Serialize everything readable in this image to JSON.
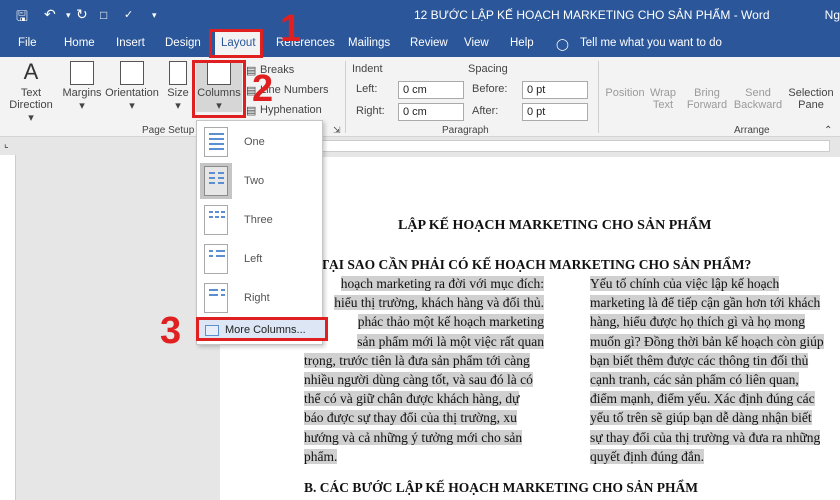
{
  "titlebar": {
    "title": "12 BƯỚC LẬP KẾ HOẠCH MARKETING CHO SẢN PHẨM  -  Word",
    "user": "Ng",
    "save_icon": "save-icon",
    "undo_icon": "undo-icon",
    "redo_icon": "redo-icon"
  },
  "menu": {
    "file": "File",
    "home": "Home",
    "insert": "Insert",
    "design": "Design",
    "layout": "Layout",
    "references": "References",
    "mailings": "Mailings",
    "review": "Review",
    "view": "View",
    "help": "Help",
    "tell_me": "Tell me what you want to do"
  },
  "ribbon": {
    "text_direction": "Text",
    "text_direction2": "Direction",
    "margins": "Margins",
    "orientation": "Orientation",
    "size": "Size",
    "columns": "Columns",
    "breaks": "Breaks",
    "line_numbers": "Line Numbers",
    "hyphenation": "Hyphenation",
    "page_setup": "Page Setup",
    "indent": "Indent",
    "spacing": "Spacing",
    "left": "Left:",
    "right": "Right:",
    "before": "Before:",
    "after": "After:",
    "left_val": "0 cm",
    "right_val": "0 cm",
    "before_val": "0 pt",
    "after_val": "0 pt",
    "paragraph": "Paragraph",
    "position": "Position",
    "wrap_text": "Wrap",
    "wrap_text2": "Text",
    "bring_forward": "Bring",
    "bring_forward2": "Forward",
    "send_backward": "Send",
    "send_backward2": "Backward",
    "selection_pane": "Selection",
    "selection_pane2": "Pane",
    "arrange": "Arrange"
  },
  "columns_menu": {
    "items": [
      "One",
      "Two",
      "Three",
      "Left",
      "Right"
    ],
    "more": "More Columns..."
  },
  "callouts": {
    "n1": "1",
    "n2": "2",
    "n3": "3"
  },
  "document": {
    "title": "LẬP KẾ HOẠCH MARKETING CHO SẢN PHẨM",
    "heading_a": "TẠI SAO CẦN PHẢI CÓ KẾ HOẠCH MARKETING CHO SẢN PHẨM?",
    "col1": [
      "hoạch marketing ra đời với mục đích:",
      "hiểu thị trường, khách hàng và đối thủ.",
      "phác thảo một kế hoạch marketing",
      "sản phẩm mới là một việc rất quan",
      "trọng, trước tiên là đưa sản phẩm tới càng",
      "nhiều người dùng càng tốt, và sau đó là có",
      "thể có và giữ chân được khách hàng, dự",
      "báo được sự thay đổi của thị trường, xu",
      "hướng và cả những ý tưởng mới cho sản",
      "phẩm."
    ],
    "col2": [
      "Yếu tố chính của việc lập kế hoạch",
      "marketing là để tiếp cận gần hơn tới khách",
      "hàng, hiểu được họ thích gì và họ mong",
      "muốn gì? Đồng thời bản kế hoạch còn giúp",
      "bạn biết thêm được các thông tin đối thủ",
      "cạnh tranh, các sản phẩm có liên quan,",
      "điểm mạnh, điểm yếu. Xác định đúng các",
      "yếu tố trên sẽ giúp bạn dễ dàng nhận biết",
      "sự thay đổi của thị trường và đưa ra những",
      "quyết định đúng đắn."
    ],
    "heading_b": "B. CÁC BƯỚC LẬP KẾ HOẠCH MARKETING CHO SẢN PHẨM"
  }
}
